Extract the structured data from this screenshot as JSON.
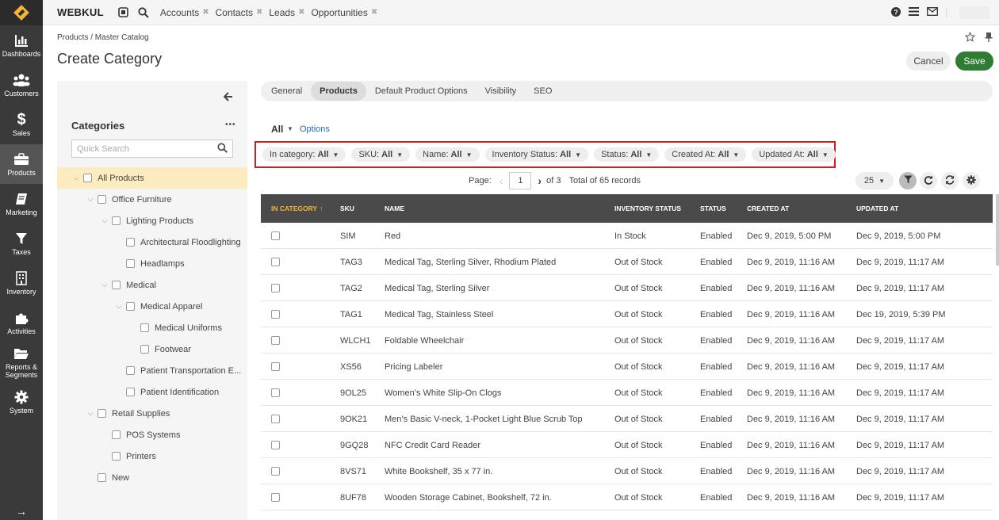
{
  "sidebar": {
    "items": [
      {
        "label": "Dashboards",
        "icon": "bar-chart-icon"
      },
      {
        "label": "Customers",
        "icon": "users-icon"
      },
      {
        "label": "Sales",
        "icon": "dollar-icon"
      },
      {
        "label": "Products",
        "icon": "briefcase-icon"
      },
      {
        "label": "Marketing",
        "icon": "book-icon"
      },
      {
        "label": "Taxes",
        "icon": "funnel-icon"
      },
      {
        "label": "Inventory",
        "icon": "building-icon"
      },
      {
        "label": "Activities",
        "icon": "puzzle-icon"
      },
      {
        "label": "Reports & Segments",
        "icon": "folder-open-icon"
      },
      {
        "label": "System",
        "icon": "gear-icon"
      }
    ]
  },
  "topbar": {
    "brand": "WEBKUL",
    "tabs": [
      {
        "label": "Accounts"
      },
      {
        "label": "Contacts"
      },
      {
        "label": "Leads"
      },
      {
        "label": "Opportunities"
      }
    ]
  },
  "breadcrumb": "Products / Master Catalog",
  "page_title": "Create Category",
  "actions": {
    "cancel": "Cancel",
    "save": "Save"
  },
  "categories": {
    "title": "Categories",
    "menu": "•••",
    "search_placeholder": "Quick Search",
    "tree": [
      {
        "label": "All Products",
        "level": 0,
        "expanded": true,
        "selected": true
      },
      {
        "label": "Office Furniture",
        "level": 1,
        "expanded": true
      },
      {
        "label": "Lighting Products",
        "level": 2,
        "expanded": true
      },
      {
        "label": "Architectural Floodlighting",
        "level": 3
      },
      {
        "label": "Headlamps",
        "level": 3
      },
      {
        "label": "Medical",
        "level": 2,
        "expanded": true
      },
      {
        "label": "Medical Apparel",
        "level": 3,
        "expanded": true
      },
      {
        "label": "Medical Uniforms",
        "level": 4
      },
      {
        "label": "Footwear",
        "level": 4
      },
      {
        "label": "Patient Transportation E...",
        "level": 3
      },
      {
        "label": "Patient Identification",
        "level": 3
      },
      {
        "label": "Retail Supplies",
        "level": 1,
        "expanded": true
      },
      {
        "label": "POS Systems",
        "level": 2
      },
      {
        "label": "Printers",
        "level": 2
      },
      {
        "label": "New",
        "level": 1
      }
    ]
  },
  "tabs": [
    {
      "label": "General"
    },
    {
      "label": "Products",
      "active": true
    },
    {
      "label": "Default Product Options"
    },
    {
      "label": "Visibility"
    },
    {
      "label": "SEO"
    }
  ],
  "grid": {
    "view_label": "All",
    "options_label": "Options",
    "filters": [
      {
        "name": "In category:",
        "value": "All"
      },
      {
        "name": "SKU:",
        "value": "All"
      },
      {
        "name": "Name:",
        "value": "All"
      },
      {
        "name": "Inventory Status:",
        "value": "All"
      },
      {
        "name": "Status:",
        "value": "All"
      },
      {
        "name": "Created At:",
        "value": "All"
      },
      {
        "name": "Updated At:",
        "value": "All"
      }
    ],
    "pager": {
      "label": "Page:",
      "current": "1",
      "of": "of 3",
      "total": "Total of 65 records",
      "per_page": "25"
    },
    "columns": [
      "IN CATEGORY",
      "SKU",
      "NAME",
      "INVENTORY STATUS",
      "STATUS",
      "CREATED AT",
      "UPDATED AT"
    ],
    "rows": [
      {
        "sku": "SIM",
        "name": "Red",
        "inventory": "In Stock",
        "status": "Enabled",
        "created": "Dec 9, 2019, 5:00 PM",
        "updated": "Dec 9, 2019, 5:00 PM"
      },
      {
        "sku": "TAG3",
        "name": "Medical Tag, Sterling Silver, Rhodium Plated",
        "inventory": "Out of Stock",
        "status": "Enabled",
        "created": "Dec 9, 2019, 11:16 AM",
        "updated": "Dec 9, 2019, 11:17 AM"
      },
      {
        "sku": "TAG2",
        "name": "Medical Tag, Sterling Silver",
        "inventory": "Out of Stock",
        "status": "Enabled",
        "created": "Dec 9, 2019, 11:16 AM",
        "updated": "Dec 9, 2019, 11:17 AM"
      },
      {
        "sku": "TAG1",
        "name": "Medical Tag, Stainless Steel",
        "inventory": "Out of Stock",
        "status": "Enabled",
        "created": "Dec 9, 2019, 11:16 AM",
        "updated": "Dec 19, 2019, 5:39 PM"
      },
      {
        "sku": "WLCH1",
        "name": "Foldable Wheelchair",
        "inventory": "Out of Stock",
        "status": "Enabled",
        "created": "Dec 9, 2019, 11:16 AM",
        "updated": "Dec 9, 2019, 11:17 AM"
      },
      {
        "sku": "XS56",
        "name": "Pricing Labeler",
        "inventory": "Out of Stock",
        "status": "Enabled",
        "created": "Dec 9, 2019, 11:16 AM",
        "updated": "Dec 9, 2019, 11:17 AM"
      },
      {
        "sku": "9OL25",
        "name": "Women’s White Slip-On Clogs",
        "inventory": "Out of Stock",
        "status": "Enabled",
        "created": "Dec 9, 2019, 11:16 AM",
        "updated": "Dec 9, 2019, 11:17 AM"
      },
      {
        "sku": "9OK21",
        "name": "Men’s Basic V-neck, 1-Pocket Light Blue Scrub Top",
        "inventory": "Out of Stock",
        "status": "Enabled",
        "created": "Dec 9, 2019, 11:16 AM",
        "updated": "Dec 9, 2019, 11:17 AM"
      },
      {
        "sku": "9GQ28",
        "name": "NFC Credit Card Reader",
        "inventory": "Out of Stock",
        "status": "Enabled",
        "created": "Dec 9, 2019, 11:16 AM",
        "updated": "Dec 9, 2019, 11:17 AM"
      },
      {
        "sku": "8VS71",
        "name": "White Bookshelf, 35 x 77 in.",
        "inventory": "Out of Stock",
        "status": "Enabled",
        "created": "Dec 9, 2019, 11:16 AM",
        "updated": "Dec 9, 2019, 11:17 AM"
      },
      {
        "sku": "8UF78",
        "name": "Wooden Storage Cabinet, Bookshelf, 72 in.",
        "inventory": "Out of Stock",
        "status": "Enabled",
        "created": "Dec 9, 2019, 11:16 AM",
        "updated": "Dec 9, 2019, 11:17 AM"
      }
    ]
  },
  "colors": {
    "accent": "#2e7d32",
    "highlight": "#cc1f1f",
    "sorted_header": "#f1b53a"
  }
}
